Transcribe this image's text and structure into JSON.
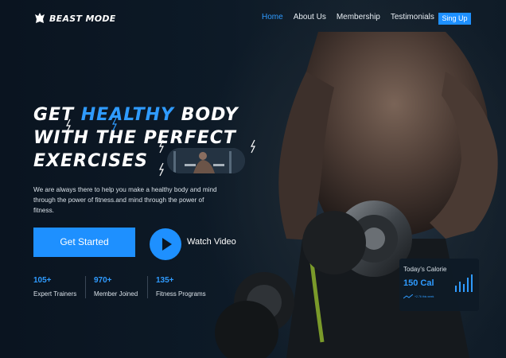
{
  "brand": {
    "name": "BEAST MODE",
    "logo_icon": "beast-head-icon"
  },
  "nav": {
    "items": [
      {
        "label": "Home",
        "active": true
      },
      {
        "label": "About Us",
        "active": false
      },
      {
        "label": "Membership",
        "active": false
      },
      {
        "label": "Testimonials",
        "active": false
      }
    ],
    "signup_label": "Sing Up"
  },
  "hero": {
    "headline_line1_pre": "GET ",
    "headline_line1_highlight": "HEALTHY",
    "headline_line1_post": " BODY",
    "headline_line2": "WITH THE PERFECT",
    "headline_line3": "EXERCISES",
    "description": "We are always there to help you make a healthy body and mind through the power of fitness.and mind through the power of fitness.",
    "cta_label": "Get Started",
    "watch_label": "Watch Video"
  },
  "stats": [
    {
      "number": "105+",
      "label": "Expert Trainers"
    },
    {
      "number": "970+",
      "label": "Member Joined"
    },
    {
      "number": "135+",
      "label": "Fitness Programs"
    }
  ],
  "calorie_card": {
    "title": "Today's Calorie",
    "value": "150 Cal",
    "subtext": "+2.76 this week"
  },
  "colors": {
    "accent": "#1e90ff",
    "background": "#0b1622"
  }
}
